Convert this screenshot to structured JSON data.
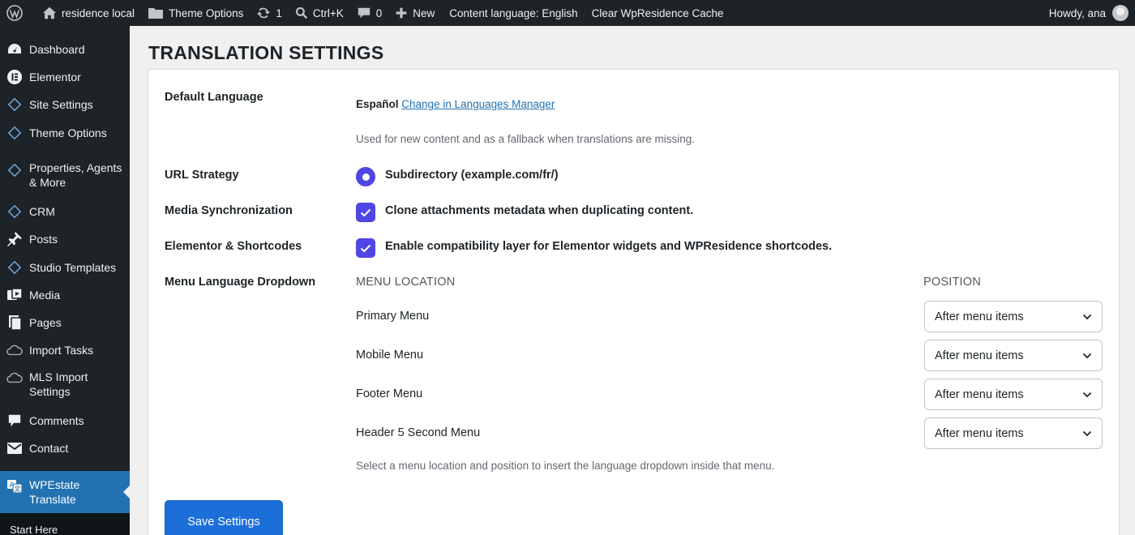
{
  "adminbar": {
    "site_name": "residence local",
    "theme_options": "Theme Options",
    "updates_count": "1",
    "search_shortcut": "Ctrl+K",
    "comments_count": "0",
    "new_label": "New",
    "content_language": "Content language: English",
    "clear_cache": "Clear WpResidence Cache",
    "howdy": "Howdy, ana"
  },
  "sidebar": {
    "items": [
      {
        "label": "Dashboard",
        "icon": "dashboard-icon"
      },
      {
        "label": "Elementor",
        "icon": "elementor-icon"
      },
      {
        "label": "Site Settings",
        "icon": "diamond-icon"
      },
      {
        "label": "Theme Options",
        "icon": "diamond-icon"
      },
      {
        "label": "Properties, Agents & More",
        "icon": "diamond-icon"
      },
      {
        "label": "CRM",
        "icon": "diamond-icon"
      },
      {
        "label": "Posts",
        "icon": "pin-icon"
      },
      {
        "label": "Studio Templates",
        "icon": "diamond-icon"
      },
      {
        "label": "Media",
        "icon": "media-icon"
      },
      {
        "label": "Pages",
        "icon": "pages-icon"
      },
      {
        "label": "Import Tasks",
        "icon": "cloud-icon"
      },
      {
        "label": "MLS Import Settings",
        "icon": "cloud-icon"
      },
      {
        "label": "Comments",
        "icon": "comment-icon"
      },
      {
        "label": "Contact",
        "icon": "mail-icon"
      },
      {
        "label": "WPEstate Translate",
        "icon": "translate-icon"
      }
    ],
    "submenu_first": "Start Here"
  },
  "page": {
    "title": "TRANSLATION SETTINGS"
  },
  "settings": {
    "default_language": {
      "label": "Default Language",
      "value": "Español",
      "link": "Change in Languages Manager",
      "help": "Used for new content and as a fallback when translations are missing."
    },
    "url_strategy": {
      "label": "URL Strategy",
      "option": "Subdirectory (example.com/fr/)"
    },
    "media_sync": {
      "label": "Media Synchronization",
      "option": "Clone attachments metadata when duplicating content."
    },
    "elementor": {
      "label": "Elementor & Shortcodes",
      "option": "Enable compatibility layer for Elementor widgets and WPResidence shortcodes."
    },
    "menu_dropdown": {
      "label": "Menu Language Dropdown",
      "col_location": "MENU LOCATION",
      "col_position": "POSITION",
      "rows": [
        {
          "location": "Primary Menu",
          "position": "After menu items"
        },
        {
          "location": "Mobile Menu",
          "position": "After menu items"
        },
        {
          "location": "Footer Menu",
          "position": "After menu items"
        },
        {
          "location": "Header 5 Second Menu",
          "position": "After menu items"
        }
      ],
      "help": "Select a menu location and position to insert the language dropdown inside that menu."
    }
  },
  "save_label": "Save Settings",
  "colors": {
    "accent": "#4f46e5",
    "button": "#1c6fd8",
    "admin_dark": "#1d2327",
    "current_menu": "#2271b1"
  }
}
